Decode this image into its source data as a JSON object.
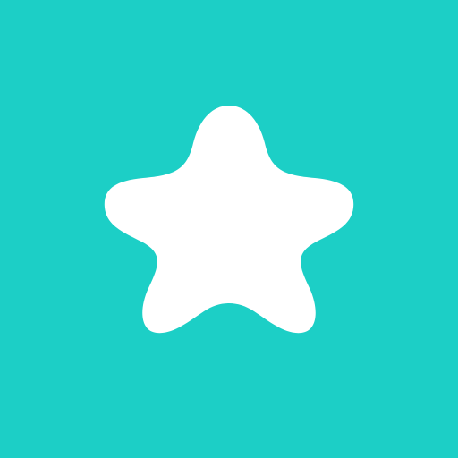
{
  "icon": {
    "name": "star-icon",
    "background_color": "#1CCFC6",
    "glyph_color": "#FFFFFF"
  }
}
